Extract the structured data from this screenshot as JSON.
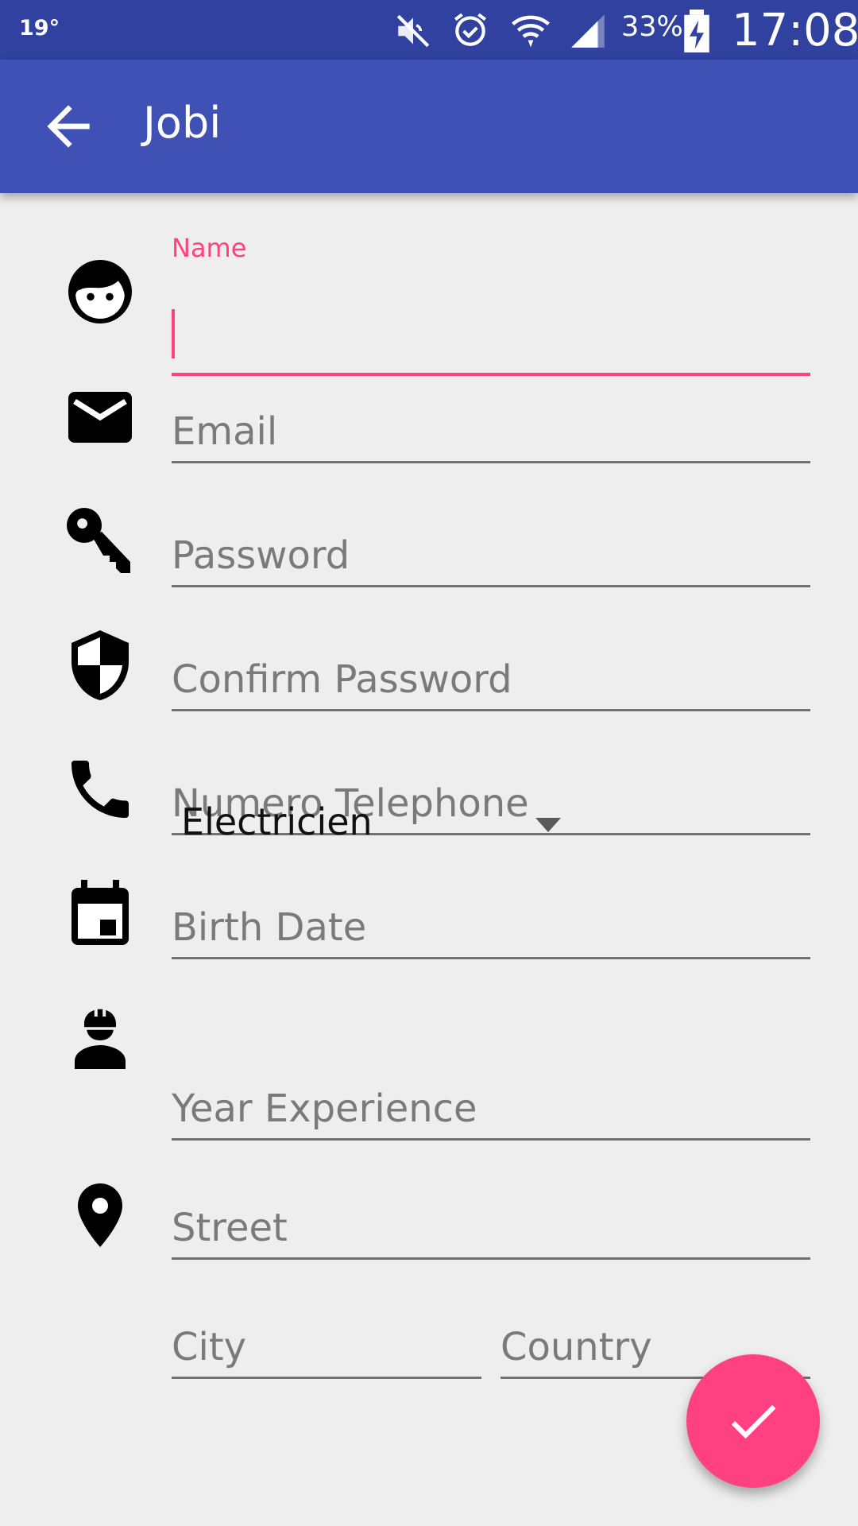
{
  "status_bar": {
    "temperature": "19°",
    "battery_percent": "33%",
    "time": "17:08",
    "icons": [
      "mute-icon",
      "alarm-icon",
      "wifi-icon",
      "signal-icon",
      "battery-charging-icon"
    ]
  },
  "app_bar": {
    "title": "Jobi",
    "back_icon": "arrow-back-icon"
  },
  "form": {
    "name": {
      "label": "Name",
      "value": ""
    },
    "email": {
      "placeholder": "Email"
    },
    "password": {
      "placeholder": "Password"
    },
    "confirm_password": {
      "placeholder": "Confirm Password"
    },
    "phone": {
      "placeholder": "Numero Telephone"
    },
    "birth_date": {
      "placeholder": "Birth Date"
    },
    "profession": {
      "selected": "Electricien"
    },
    "experience": {
      "placeholder": "Year Experience"
    },
    "street": {
      "placeholder": "Street"
    },
    "city": {
      "placeholder": "City"
    },
    "country": {
      "placeholder": "Country"
    }
  },
  "fab": {
    "icon": "check-icon"
  },
  "colors": {
    "status_bar": "#3041a0",
    "app_bar": "#3f51b5",
    "accent": "#ff4081",
    "background": "#eeeeee"
  }
}
